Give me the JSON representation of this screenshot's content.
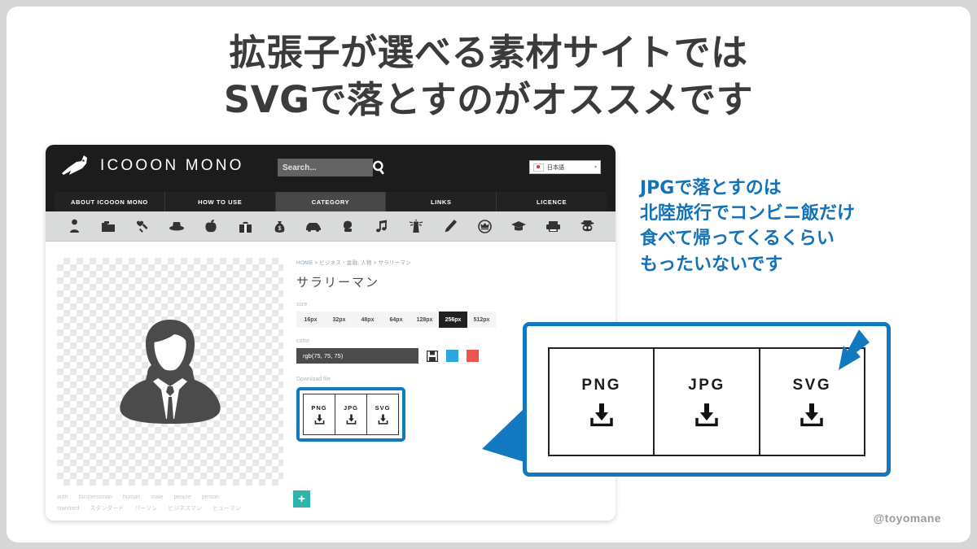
{
  "headline": {
    "line1": "拡張子が選べる素材サイトでは",
    "line2": "SVGで落とすのがオススメです",
    "color": "#3b3b3b"
  },
  "annotation": {
    "color": "#1272b8",
    "line1": "JPGで落とすのは",
    "line2": "北陸旅行でコンビニ飯だけ",
    "line3": "食べて帰ってくるくらい",
    "line4": "もったいないです"
  },
  "site": {
    "logo_text": "ICOOON MONO",
    "logo_icon": "horse-head-icon",
    "search": {
      "placeholder": "Search...",
      "value": ""
    },
    "search_icon": "search-icon",
    "language": {
      "label": "日本語",
      "flag": "japan-flag-icon",
      "caret": "▾"
    },
    "nav": [
      {
        "label": "ABOUT ICOOON MONO",
        "active": false
      },
      {
        "label": "HOW TO USE",
        "active": false
      },
      {
        "label": "CATEGORY",
        "active": true
      },
      {
        "label": "LINKS",
        "active": false
      },
      {
        "label": "LICENCE",
        "active": false
      }
    ],
    "category_icons": [
      "person-icon",
      "folder-icon",
      "syringe-heart-icon",
      "hat-icon",
      "apple-icon",
      "gift-icon",
      "money-bag-icon",
      "car-icon",
      "boxing-glove-icon",
      "music-note-icon",
      "lighthouse-icon",
      "pencil-icon",
      "crown-circle-icon",
      "graduation-cap-icon",
      "printer-icon",
      "skull-hat-icon"
    ],
    "breadcrumb": "HOME > ビジネス・金融, 人物 > サラリーマン",
    "item_title": "サラリーマン",
    "preview_icon": "salaryman-icon",
    "size": {
      "label": "size",
      "options": [
        "16px",
        "32px",
        "48px",
        "64px",
        "128px",
        "256px",
        "512px"
      ],
      "selected": "256px"
    },
    "color": {
      "label": "color",
      "value": "rgb(75, 75, 75)",
      "save_icon": "save-disk-icon",
      "swatches": [
        "#2aa7dd",
        "#ef5350"
      ]
    },
    "download": {
      "label": "Download file",
      "buttons": [
        {
          "format": "PNG",
          "icon": "download-icon"
        },
        {
          "format": "JPG",
          "icon": "download-icon"
        },
        {
          "format": "SVG",
          "icon": "download-icon"
        }
      ]
    },
    "tags": {
      "row1": [
        "auth",
        "businessman",
        "human",
        "male",
        "people",
        "person"
      ],
      "row2": [
        "standard",
        "スタンダード",
        "パーソン",
        "ビジネスマン",
        "ヒューマン"
      ],
      "add_label": "+"
    }
  },
  "callout": {
    "buttons": [
      {
        "format": "PNG",
        "icon": "download-icon"
      },
      {
        "format": "JPG",
        "icon": "download-icon"
      },
      {
        "format": "SVG",
        "icon": "download-icon"
      }
    ],
    "arrow_icon": "blue-arrow-icon",
    "border_color": "#1279c0"
  },
  "watermark": "@toyomane"
}
